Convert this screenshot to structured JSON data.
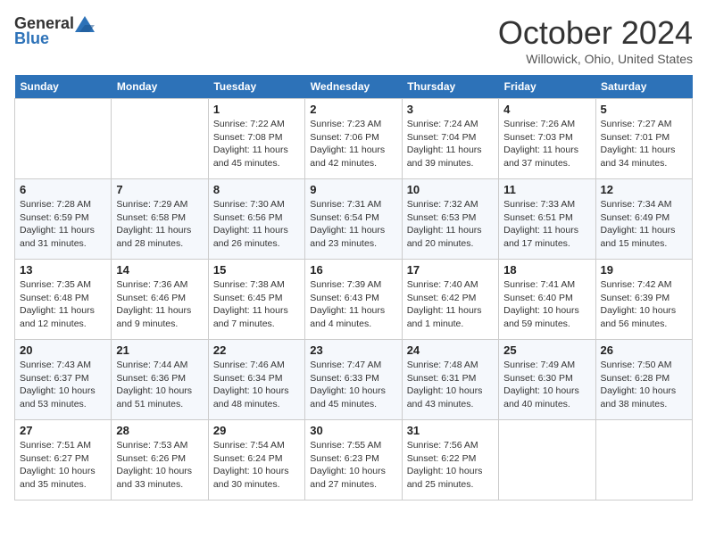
{
  "logo": {
    "general": "General",
    "blue": "Blue"
  },
  "title": "October 2024",
  "location": "Willowick, Ohio, United States",
  "days_of_week": [
    "Sunday",
    "Monday",
    "Tuesday",
    "Wednesday",
    "Thursday",
    "Friday",
    "Saturday"
  ],
  "weeks": [
    [
      {
        "day": "",
        "info": ""
      },
      {
        "day": "",
        "info": ""
      },
      {
        "day": "1",
        "sunrise": "Sunrise: 7:22 AM",
        "sunset": "Sunset: 7:08 PM",
        "daylight": "Daylight: 11 hours and 45 minutes."
      },
      {
        "day": "2",
        "sunrise": "Sunrise: 7:23 AM",
        "sunset": "Sunset: 7:06 PM",
        "daylight": "Daylight: 11 hours and 42 minutes."
      },
      {
        "day": "3",
        "sunrise": "Sunrise: 7:24 AM",
        "sunset": "Sunset: 7:04 PM",
        "daylight": "Daylight: 11 hours and 39 minutes."
      },
      {
        "day": "4",
        "sunrise": "Sunrise: 7:26 AM",
        "sunset": "Sunset: 7:03 PM",
        "daylight": "Daylight: 11 hours and 37 minutes."
      },
      {
        "day": "5",
        "sunrise": "Sunrise: 7:27 AM",
        "sunset": "Sunset: 7:01 PM",
        "daylight": "Daylight: 11 hours and 34 minutes."
      }
    ],
    [
      {
        "day": "6",
        "sunrise": "Sunrise: 7:28 AM",
        "sunset": "Sunset: 6:59 PM",
        "daylight": "Daylight: 11 hours and 31 minutes."
      },
      {
        "day": "7",
        "sunrise": "Sunrise: 7:29 AM",
        "sunset": "Sunset: 6:58 PM",
        "daylight": "Daylight: 11 hours and 28 minutes."
      },
      {
        "day": "8",
        "sunrise": "Sunrise: 7:30 AM",
        "sunset": "Sunset: 6:56 PM",
        "daylight": "Daylight: 11 hours and 26 minutes."
      },
      {
        "day": "9",
        "sunrise": "Sunrise: 7:31 AM",
        "sunset": "Sunset: 6:54 PM",
        "daylight": "Daylight: 11 hours and 23 minutes."
      },
      {
        "day": "10",
        "sunrise": "Sunrise: 7:32 AM",
        "sunset": "Sunset: 6:53 PM",
        "daylight": "Daylight: 11 hours and 20 minutes."
      },
      {
        "day": "11",
        "sunrise": "Sunrise: 7:33 AM",
        "sunset": "Sunset: 6:51 PM",
        "daylight": "Daylight: 11 hours and 17 minutes."
      },
      {
        "day": "12",
        "sunrise": "Sunrise: 7:34 AM",
        "sunset": "Sunset: 6:49 PM",
        "daylight": "Daylight: 11 hours and 15 minutes."
      }
    ],
    [
      {
        "day": "13",
        "sunrise": "Sunrise: 7:35 AM",
        "sunset": "Sunset: 6:48 PM",
        "daylight": "Daylight: 11 hours and 12 minutes."
      },
      {
        "day": "14",
        "sunrise": "Sunrise: 7:36 AM",
        "sunset": "Sunset: 6:46 PM",
        "daylight": "Daylight: 11 hours and 9 minutes."
      },
      {
        "day": "15",
        "sunrise": "Sunrise: 7:38 AM",
        "sunset": "Sunset: 6:45 PM",
        "daylight": "Daylight: 11 hours and 7 minutes."
      },
      {
        "day": "16",
        "sunrise": "Sunrise: 7:39 AM",
        "sunset": "Sunset: 6:43 PM",
        "daylight": "Daylight: 11 hours and 4 minutes."
      },
      {
        "day": "17",
        "sunrise": "Sunrise: 7:40 AM",
        "sunset": "Sunset: 6:42 PM",
        "daylight": "Daylight: 11 hours and 1 minute."
      },
      {
        "day": "18",
        "sunrise": "Sunrise: 7:41 AM",
        "sunset": "Sunset: 6:40 PM",
        "daylight": "Daylight: 10 hours and 59 minutes."
      },
      {
        "day": "19",
        "sunrise": "Sunrise: 7:42 AM",
        "sunset": "Sunset: 6:39 PM",
        "daylight": "Daylight: 10 hours and 56 minutes."
      }
    ],
    [
      {
        "day": "20",
        "sunrise": "Sunrise: 7:43 AM",
        "sunset": "Sunset: 6:37 PM",
        "daylight": "Daylight: 10 hours and 53 minutes."
      },
      {
        "day": "21",
        "sunrise": "Sunrise: 7:44 AM",
        "sunset": "Sunset: 6:36 PM",
        "daylight": "Daylight: 10 hours and 51 minutes."
      },
      {
        "day": "22",
        "sunrise": "Sunrise: 7:46 AM",
        "sunset": "Sunset: 6:34 PM",
        "daylight": "Daylight: 10 hours and 48 minutes."
      },
      {
        "day": "23",
        "sunrise": "Sunrise: 7:47 AM",
        "sunset": "Sunset: 6:33 PM",
        "daylight": "Daylight: 10 hours and 45 minutes."
      },
      {
        "day": "24",
        "sunrise": "Sunrise: 7:48 AM",
        "sunset": "Sunset: 6:31 PM",
        "daylight": "Daylight: 10 hours and 43 minutes."
      },
      {
        "day": "25",
        "sunrise": "Sunrise: 7:49 AM",
        "sunset": "Sunset: 6:30 PM",
        "daylight": "Daylight: 10 hours and 40 minutes."
      },
      {
        "day": "26",
        "sunrise": "Sunrise: 7:50 AM",
        "sunset": "Sunset: 6:28 PM",
        "daylight": "Daylight: 10 hours and 38 minutes."
      }
    ],
    [
      {
        "day": "27",
        "sunrise": "Sunrise: 7:51 AM",
        "sunset": "Sunset: 6:27 PM",
        "daylight": "Daylight: 10 hours and 35 minutes."
      },
      {
        "day": "28",
        "sunrise": "Sunrise: 7:53 AM",
        "sunset": "Sunset: 6:26 PM",
        "daylight": "Daylight: 10 hours and 33 minutes."
      },
      {
        "day": "29",
        "sunrise": "Sunrise: 7:54 AM",
        "sunset": "Sunset: 6:24 PM",
        "daylight": "Daylight: 10 hours and 30 minutes."
      },
      {
        "day": "30",
        "sunrise": "Sunrise: 7:55 AM",
        "sunset": "Sunset: 6:23 PM",
        "daylight": "Daylight: 10 hours and 27 minutes."
      },
      {
        "day": "31",
        "sunrise": "Sunrise: 7:56 AM",
        "sunset": "Sunset: 6:22 PM",
        "daylight": "Daylight: 10 hours and 25 minutes."
      },
      {
        "day": "",
        "info": ""
      },
      {
        "day": "",
        "info": ""
      }
    ]
  ]
}
